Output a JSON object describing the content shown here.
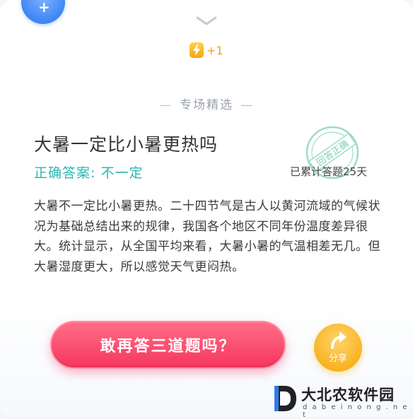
{
  "badge": {
    "icon": "plus-icon",
    "symbol": "+"
  },
  "energy": {
    "icon": "lightning-icon",
    "count": "+1"
  },
  "section": {
    "dash": "—",
    "title": "专场精选"
  },
  "question": "大暑一定比小暑更热吗",
  "answer": {
    "label": "正确答案:",
    "value": "不一定"
  },
  "stamp": {
    "text": "回答正确"
  },
  "streak": "已累计答题25天",
  "explanation": "大暑不一定比小暑更热。二十四节气是古人以黄河流域的气候状况为基础总结出来的规律，我国各个地区不同年份温度差异很大。统计显示，从全国平均来看，大暑小暑的气温相差无几。但大暑湿度更大，所以感觉天气更闷热。",
  "buttons": {
    "dare": "敢再答三道题吗？",
    "share": "分享"
  },
  "watermark": {
    "brand": "大北农软件园",
    "url": "d a b e i n o n g . n e t"
  },
  "colors": {
    "accent_pink": "#f6365f",
    "answer_teal": "#2bb7b0",
    "share_orange": "#f7b21d",
    "badge_blue": "#3d86f5"
  }
}
